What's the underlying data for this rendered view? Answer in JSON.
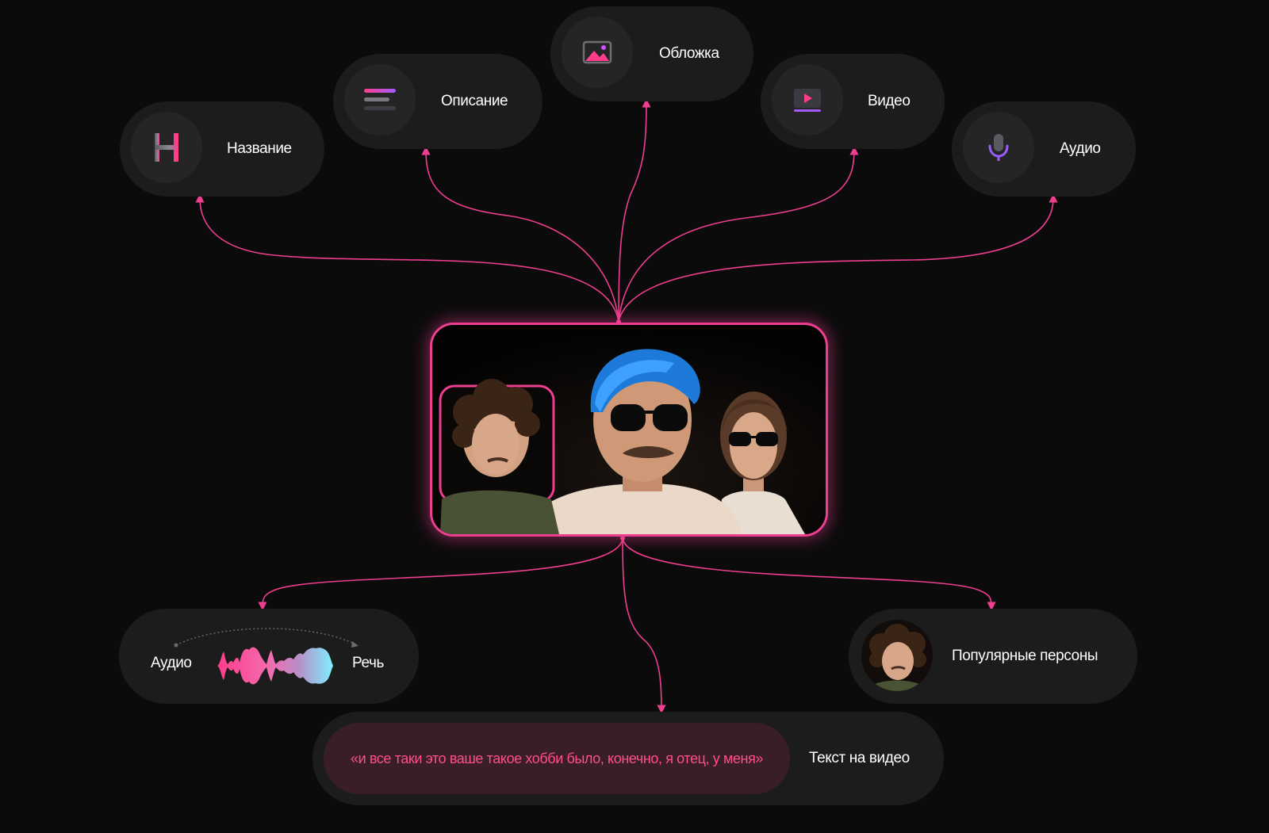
{
  "outputs_top": [
    {
      "key": "title",
      "label": "Название",
      "icon": "heading-icon"
    },
    {
      "key": "description",
      "label": "Описание",
      "icon": "text-lines-icon"
    },
    {
      "key": "cover",
      "label": "Обложка",
      "icon": "image-icon"
    },
    {
      "key": "video",
      "label": "Видео",
      "icon": "video-play-icon"
    },
    {
      "key": "audio",
      "label": "Аудио",
      "icon": "microphone-icon"
    }
  ],
  "speech": {
    "from_label": "Аудио",
    "to_label": "Речь",
    "icon": "waveform-icon"
  },
  "personas": {
    "label": "Популярные персоны",
    "icon": "person-avatar"
  },
  "video_text": {
    "quote": "«и все таки это ваше такое хобби было, конечно, я отец, у меня»",
    "label": "Текст на видео"
  },
  "colors": {
    "accent": "#ee3e8f",
    "pill_bg": "#1d1c1d",
    "icon_bg": "#262526",
    "page_bg": "#0c0b0c",
    "quote_bg": "#3a1e27",
    "quote_text": "#ff4d8d",
    "wave_start": "#ff3d8a",
    "wave_end": "#7ff0ff"
  }
}
